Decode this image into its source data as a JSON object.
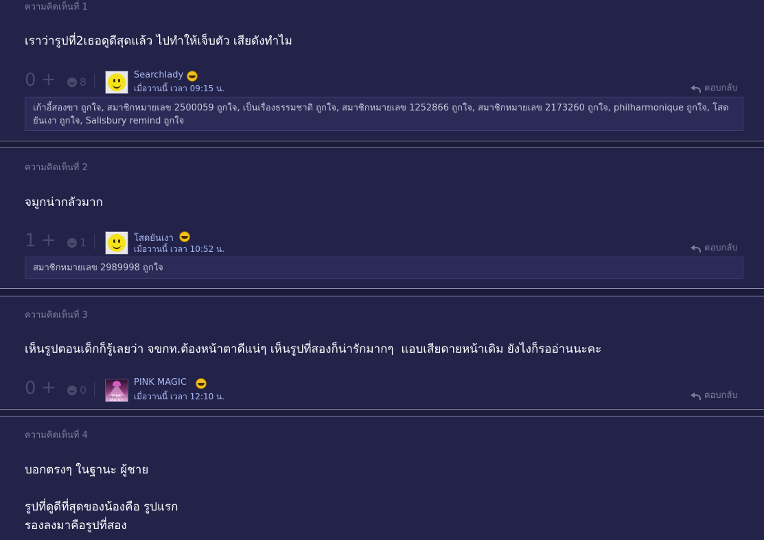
{
  "comments": [
    {
      "label": "ความคิดเห็นที่ 1",
      "body": [
        "เราว่ารูปที่2เธอดูดีสุดแล้ว ไปทำให้เจ็บตัว เสียดังทำไม"
      ],
      "score": "0",
      "plus": "+",
      "emotion_count": "8",
      "username": "Searchlady",
      "avatar": "smiley-face-avatar",
      "timestamp": "เมื่อวานนี้ เวลา 09:15 น.",
      "reply": "ตอบกลับ",
      "likes": "เก้าอี้สองขา ถูกใจ, สมาชิกหมายเลข 2500059 ถูกใจ, เป็นเรื่องธรรมชาติ ถูกใจ, สมาชิกหมายเลข 1252866 ถูกใจ, สมาชิกหมายเลข 2173260 ถูกใจ, philharmonique ถูกใจ, โสดยันเงา ถูกใจ, Salisbury remind ถูกใจ"
    },
    {
      "label": "ความคิดเห็นที่ 2",
      "body": [
        "จมูกน่ากลัวมาก"
      ],
      "score": "1",
      "plus": "+",
      "emotion_count": "1",
      "username": "โสดยันเงา",
      "avatar": "smiley-face-avatar",
      "timestamp": "เมื่อวานนี้ เวลา 10:52 น.",
      "reply": "ตอบกลับ",
      "likes": "สมาชิกหมายเลข 2989998 ถูกใจ"
    },
    {
      "label": "ความคิดเห็นที่ 3",
      "body": [
        "เห็นรูปตอนเด็กก็รู้เลยว่า จขกท.ต้องหน้าตาดีแน่ๆ เห็นรูปที่สองก็น่ารักมากๆ  แอบเสียดายหน้าเดิม ยังไงก็รออ่านนะคะ"
      ],
      "score": "0",
      "plus": "+",
      "emotion_count": "0",
      "username": "PINK MAGIC",
      "avatar": "pink-lamp-avatar",
      "avatar_text": "PINK MAGIC",
      "timestamp": "เมื่อวานนี้ เวลา 12:10 น.",
      "reply": "ตอบกลับ"
    },
    {
      "label": "ความคิดเห็นที่ 4",
      "body": [
        "บอกตรงๆ ในฐานะ ผู้ชาย",
        "",
        "รูปที่ดูดีที่สุดของน้องคือ รูปแรก",
        "รองลงมาคือรูปที่สอง"
      ]
    }
  ],
  "icons": {
    "plus": "plus-icon",
    "emotion": "emotion-icon",
    "user_badge": "smiley-badge-icon",
    "reply": "reply-arrow-icon"
  },
  "colors": {
    "background": "#1f1f3d",
    "card": "#23234a",
    "username": "#a8b8f0",
    "muted": "#7d7d9c",
    "likes_box": "#2b2b57"
  }
}
